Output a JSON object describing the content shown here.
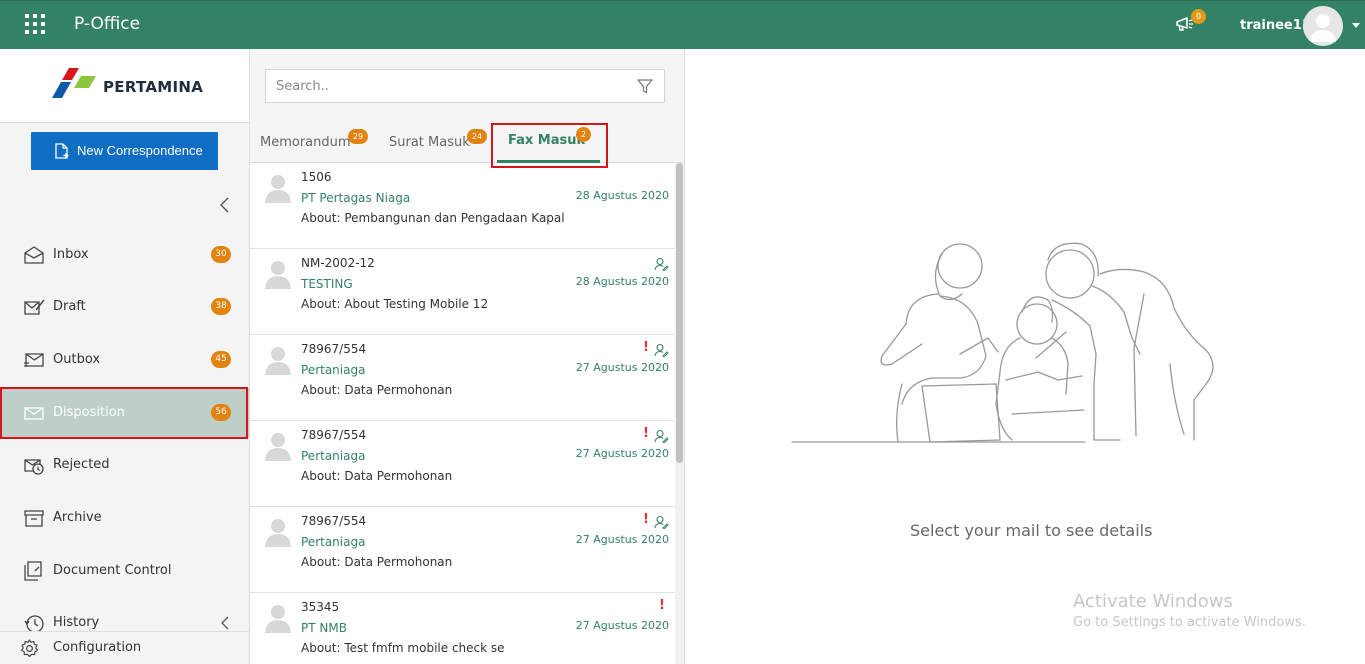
{
  "header": {
    "app_title": "P-Office",
    "notification_count": "0",
    "username": "trainee11",
    "theme_color": "#338264"
  },
  "sidebar": {
    "logo_text": "PERTAMINA",
    "new_button_label": "New Correspondence",
    "items": [
      {
        "label": "Inbox",
        "badge": "30",
        "icon": "inbox-icon"
      },
      {
        "label": "Draft",
        "badge": "38",
        "icon": "draft-icon"
      },
      {
        "label": "Outbox",
        "badge": "45",
        "icon": "outbox-icon"
      },
      {
        "label": "Disposition",
        "badge": "56",
        "icon": "disposition-icon",
        "active": true
      },
      {
        "label": "Rejected",
        "icon": "rejected-icon"
      },
      {
        "label": "Archive",
        "icon": "archive-icon"
      },
      {
        "label": "Document Control",
        "icon": "document-control-icon"
      },
      {
        "label": "History",
        "icon": "history-icon"
      }
    ],
    "config_label": "Configuration"
  },
  "search": {
    "placeholder": "Search.."
  },
  "tabs": [
    {
      "label": "Memorandum",
      "badge": "29"
    },
    {
      "label": "Surat Masuk",
      "badge": "24"
    },
    {
      "label": "Fax Masuk",
      "badge": "2",
      "active": true
    }
  ],
  "mails": [
    {
      "number": "1506",
      "from": "PT Pertagas Niaga",
      "date": "28 Agustus 2020",
      "about": "About: Pembangunan dan Pengadaan Kapal",
      "urgent": false,
      "disposed": false
    },
    {
      "number": "NM-2002-12",
      "from": "TESTING",
      "date": "28 Agustus 2020",
      "about": "About: About Testing Mobile 12",
      "urgent": false,
      "disposed": true
    },
    {
      "number": "78967/554",
      "from": "Pertaniaga",
      "date": "27 Agustus 2020",
      "about": "About: Data Permohonan",
      "urgent": true,
      "disposed": true
    },
    {
      "number": "78967/554",
      "from": "Pertaniaga",
      "date": "27 Agustus 2020",
      "about": "About: Data Permohonan",
      "urgent": true,
      "disposed": true
    },
    {
      "number": "78967/554",
      "from": "Pertaniaga",
      "date": "27 Agustus 2020",
      "about": "About: Data Permohonan",
      "urgent": true,
      "disposed": true
    },
    {
      "number": "35345",
      "from": "PT NMB",
      "date": "27 Agustus 2020",
      "about": "About: Test fmfm mobile check se",
      "urgent": true,
      "disposed": false
    }
  ],
  "urgent_mark": "!",
  "detail": {
    "empty_message": "Select your mail to see details"
  },
  "watermark": {
    "line1": "Activate Windows",
    "line2": "Go to Settings to activate Windows."
  }
}
